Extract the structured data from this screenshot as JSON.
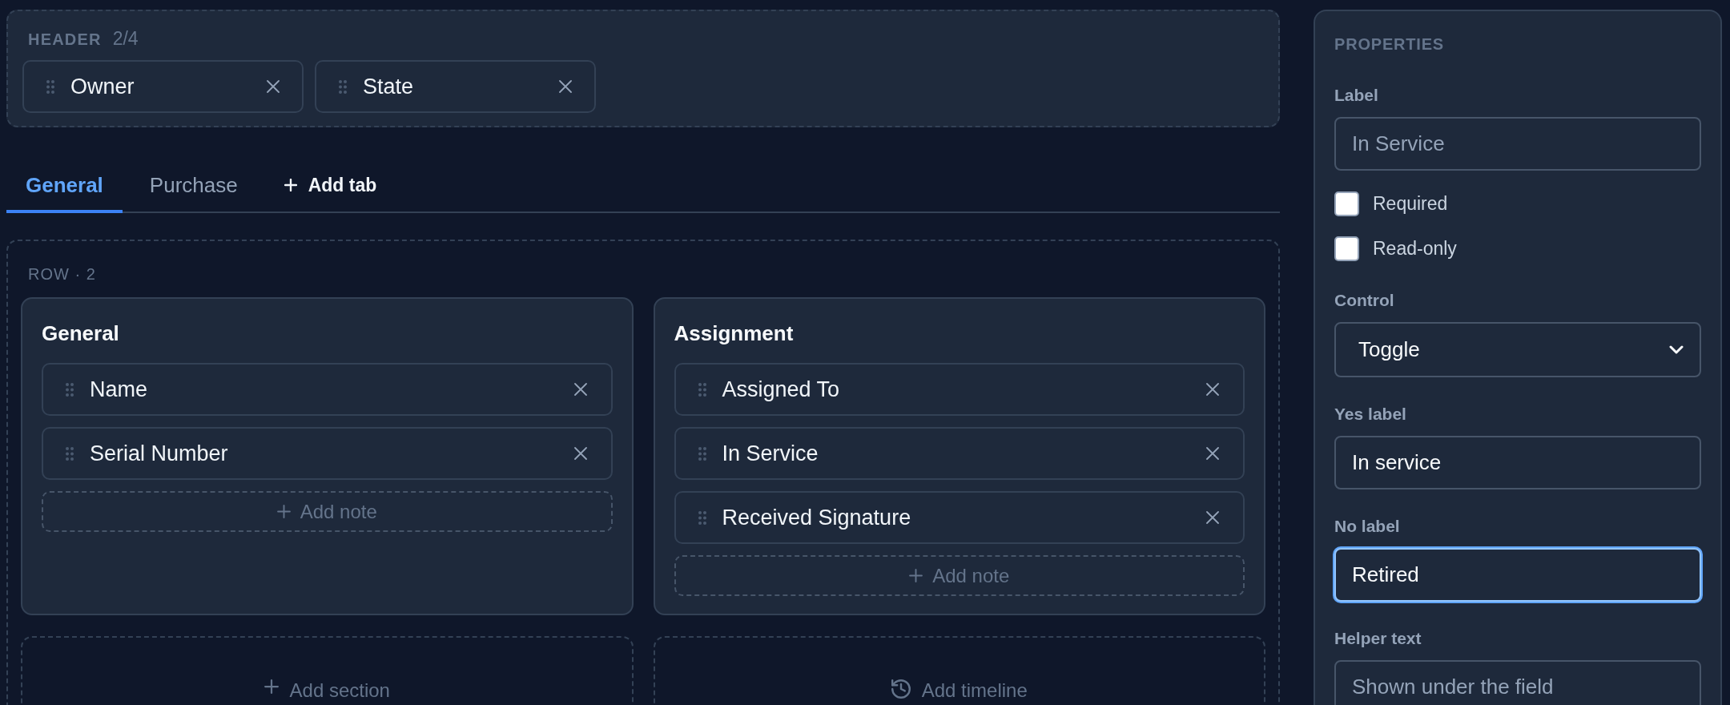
{
  "header_zone": {
    "title": "HEADER",
    "count": "2/4",
    "fields": [
      {
        "label": "Owner"
      },
      {
        "label": "State"
      }
    ]
  },
  "tabs": [
    {
      "label": "General",
      "selected": true
    },
    {
      "label": "Purchase",
      "selected": false
    }
  ],
  "add_tab": "Add tab",
  "row": {
    "title": "ROW · 2",
    "sections": [
      {
        "title": "General",
        "fields": [
          "Name",
          "Serial Number"
        ],
        "add_note": "Add note"
      },
      {
        "title": "Assignment",
        "fields": [
          "Assigned To",
          "In Service",
          "Received Signature"
        ],
        "add_note": "Add note"
      }
    ],
    "placeholders": [
      {
        "kind": "section",
        "label": "Add section"
      },
      {
        "kind": "timeline",
        "label": "Add timeline"
      }
    ]
  },
  "properties": {
    "title": "PROPERTIES",
    "items": [
      {
        "kind": "input",
        "label": "Label",
        "placeholder": "In Service",
        "focused": false
      },
      {
        "kind": "checkbox",
        "label": "Required",
        "checked": false
      },
      {
        "kind": "checkbox",
        "label": "Read-only",
        "checked": false
      },
      {
        "kind": "select",
        "label": "Control",
        "value": "Toggle"
      },
      {
        "kind": "input",
        "label": "Yes label",
        "value": "In service",
        "focused": false
      },
      {
        "kind": "input",
        "label": "No label",
        "value": "Retired",
        "focused": true
      },
      {
        "kind": "input",
        "label": "Helper text",
        "placeholder": "Shown under the field",
        "focused": false
      }
    ]
  }
}
